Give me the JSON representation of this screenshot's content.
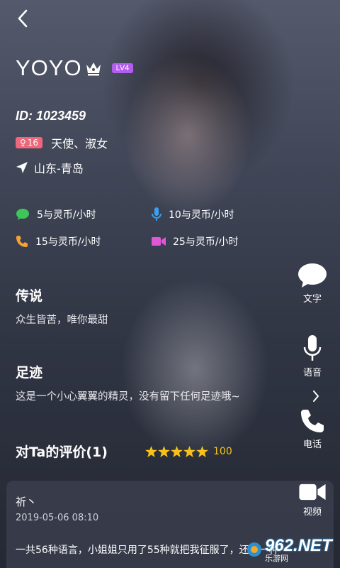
{
  "profile": {
    "name": "YOYO",
    "level": "LV4",
    "id_text": "ID: 1023459",
    "age": "16",
    "tags": "天使、淑女",
    "location": "山东-青岛"
  },
  "prices": {
    "text_rate": "5与灵币/小时",
    "voice_rate": "10与灵币/小时",
    "call_rate": "15与灵币/小时",
    "video_rate": "25与灵币/小时"
  },
  "legend": {
    "title": "传说",
    "body": "众生皆苦，唯你最甜"
  },
  "footprint": {
    "title": "足迹",
    "body": "这是一个小心翼翼的精灵，没有留下任何足迹哦~"
  },
  "evaluation": {
    "title": "对Ta的评价(1)",
    "stars": 5,
    "score": "100"
  },
  "review": {
    "name": "祈丶",
    "date": "2019-05-06 08:10",
    "text": "一共56种语言，小姐姐只用了55种就把我征服了，还差一种"
  },
  "side_actions": {
    "text_label": "文字",
    "voice_label": "语音",
    "phone_label": "电话",
    "video_label": "视频"
  },
  "watermark": {
    "brand": "962.NET",
    "sub": "乐游网"
  },
  "colors": {
    "level_badge": "#b35cf0",
    "age_badge": "#f0667a",
    "star": "#f6c21a",
    "text_icon": "#3ec65a",
    "voice_icon": "#3aa0f0",
    "call_icon": "#f5a236",
    "video_icon": "#e058d6"
  }
}
